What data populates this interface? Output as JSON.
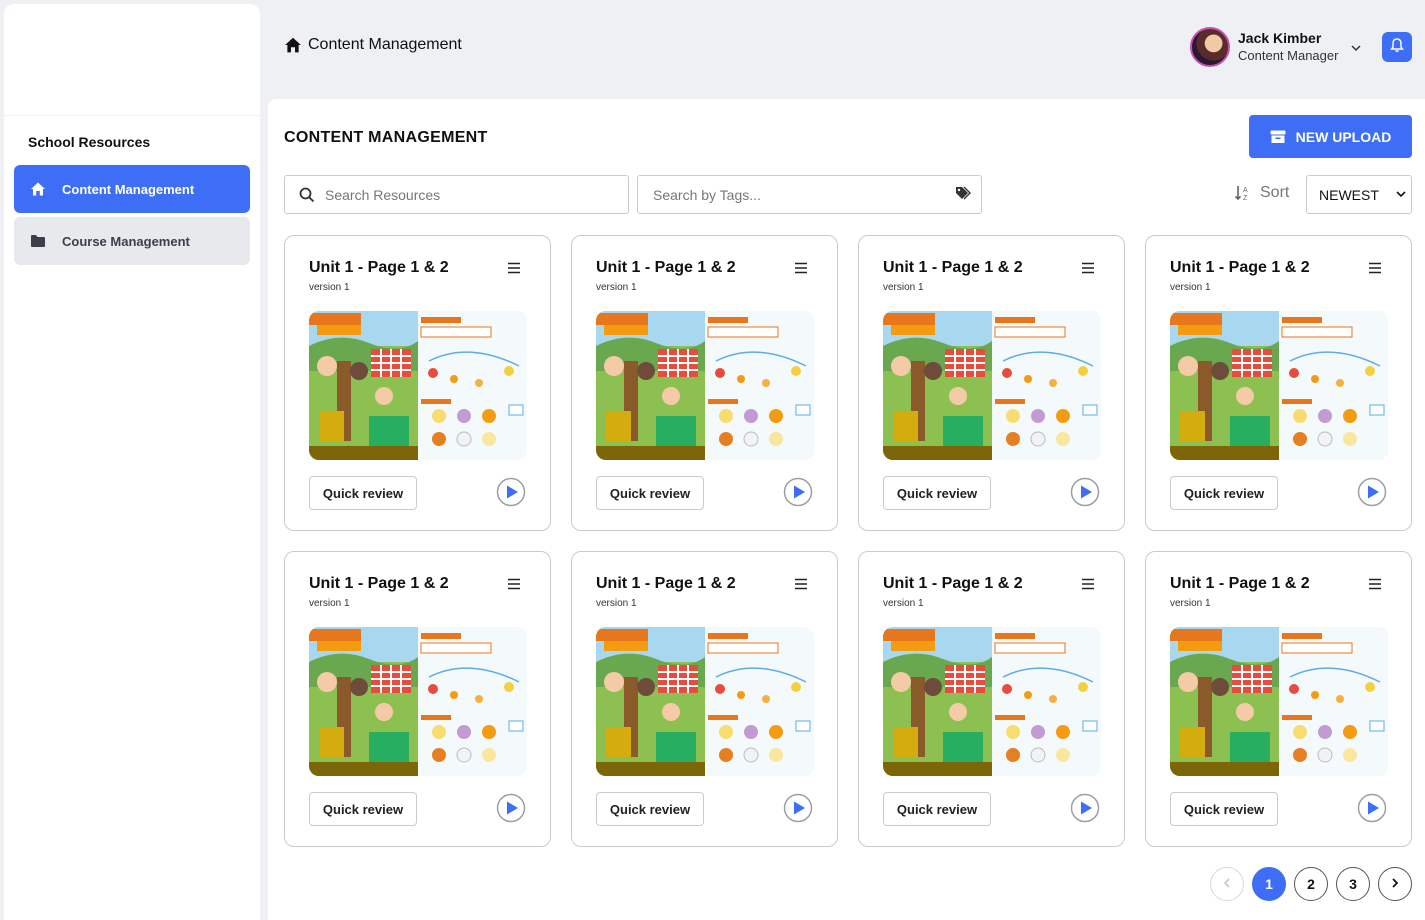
{
  "sidebar": {
    "section_title": "School Resources",
    "items": [
      {
        "label": "Content Management",
        "icon": "home-icon",
        "active": true
      },
      {
        "label": "Course Management",
        "icon": "folder-icon",
        "active": false
      }
    ]
  },
  "header": {
    "title": "Content Management",
    "user": {
      "name": "Jack Kimber",
      "role": "Content Manager"
    }
  },
  "main": {
    "title": "CONTENT MANAGEMENT",
    "upload_label": "NEW UPLOAD",
    "search_placeholder": "Search Resources",
    "tags_placeholder": "Search by Tags...",
    "sort_label": "Sort",
    "sort_value": "NEWEST"
  },
  "cards": [
    {
      "title": "Unit 1 - Page 1 & 2",
      "version": "version 1",
      "button": "Quick review"
    },
    {
      "title": "Unit 1 - Page 1 & 2",
      "version": "version 1",
      "button": "Quick review"
    },
    {
      "title": "Unit 1 - Page 1 & 2",
      "version": "version 1",
      "button": "Quick review"
    },
    {
      "title": "Unit 1 - Page 1 & 2",
      "version": "version 1",
      "button": "Quick review"
    },
    {
      "title": "Unit 1 - Page 1 & 2",
      "version": "version 1",
      "button": "Quick review"
    },
    {
      "title": "Unit 1 - Page 1 & 2",
      "version": "version 1",
      "button": "Quick review"
    },
    {
      "title": "Unit 1 - Page 1 & 2",
      "version": "version 1",
      "button": "Quick review"
    },
    {
      "title": "Unit 1 - Page 1 & 2",
      "version": "version 1",
      "button": "Quick review"
    }
  ],
  "pagination": {
    "pages": [
      "1",
      "2",
      "3"
    ],
    "current": "1"
  },
  "colors": {
    "accent": "#3d6ef5",
    "nav_inactive": "#e8e9ec",
    "background": "#eef0f4"
  }
}
